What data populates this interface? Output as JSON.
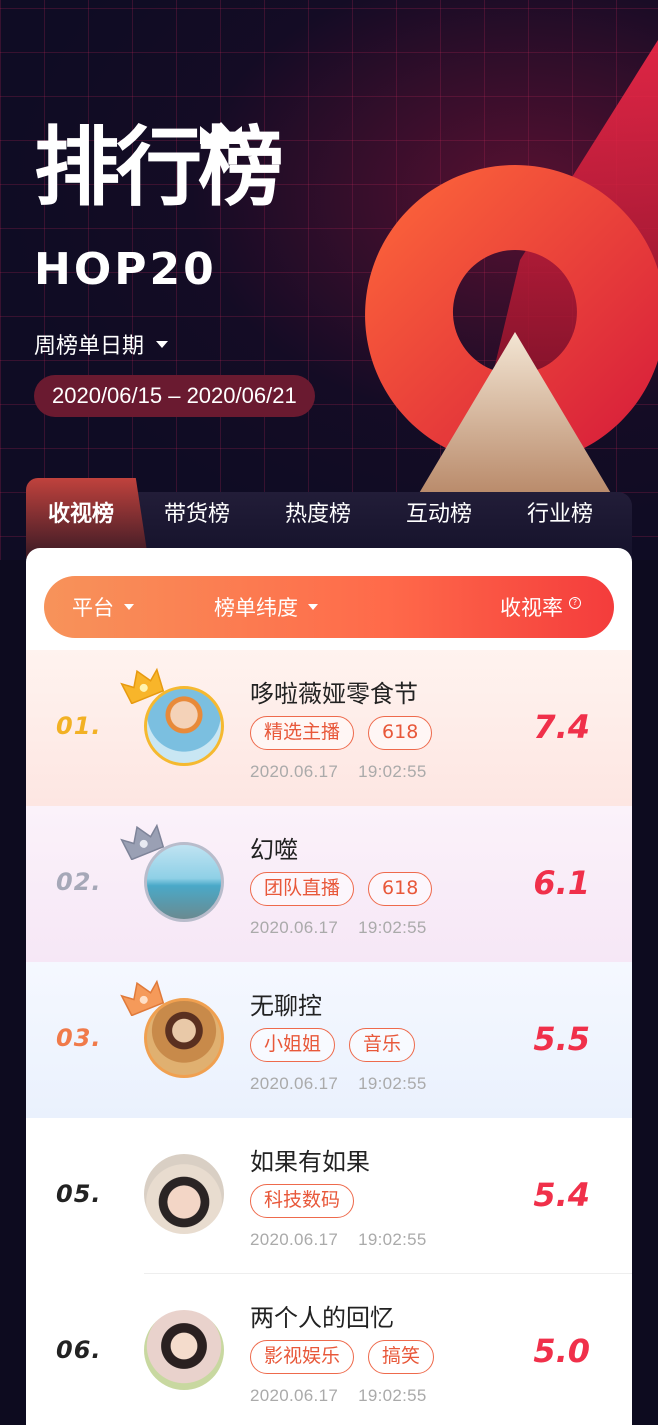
{
  "hero": {
    "title": "排行榜",
    "subtitle": "HOP20",
    "period_label": "周榜单日期",
    "date_range": "2020/06/15 – 2020/06/21"
  },
  "tabs": [
    {
      "label": "收视榜",
      "active": true
    },
    {
      "label": "带货榜",
      "active": false
    },
    {
      "label": "热度榜",
      "active": false
    },
    {
      "label": "互动榜",
      "active": false
    },
    {
      "label": "行业榜",
      "active": false
    }
  ],
  "filters": {
    "platform": "平台",
    "dimension": "榜单纬度",
    "metric": "收视率",
    "metric_help_icon": "?"
  },
  "rows": [
    {
      "rank": "01.",
      "name": "哆啦薇娅零食节",
      "tags": [
        "精选主播",
        "618"
      ],
      "date": "2020.06.17",
      "time": "19:02:55",
      "score": "7.4",
      "crown": "gold",
      "rank_color": "#f2b124"
    },
    {
      "rank": "02.",
      "name": "幻噬",
      "tags": [
        "团队直播",
        "618"
      ],
      "date": "2020.06.17",
      "time": "19:02:55",
      "score": "6.1",
      "crown": "silver",
      "rank_color": "#a6a8b8"
    },
    {
      "rank": "03.",
      "name": "无聊控",
      "tags": [
        "小姐姐",
        "音乐"
      ],
      "date": "2020.06.17",
      "time": "19:02:55",
      "score": "5.5",
      "crown": "bronze",
      "rank_color": "#f07a4a"
    },
    {
      "rank": "05.",
      "name": "如果有如果",
      "tags": [
        "科技数码"
      ],
      "date": "2020.06.17",
      "time": "19:02:55",
      "score": "5.4",
      "crown": "none",
      "rank_color": "#222222"
    },
    {
      "rank": "06.",
      "name": "两个人的回忆",
      "tags": [
        "影视娱乐",
        "搞笑"
      ],
      "date": "2020.06.17",
      "time": "19:02:55",
      "score": "5.0",
      "crown": "none",
      "rank_color": "#222222"
    }
  ],
  "colors": {
    "accent": "#ff6a4a",
    "score": "#f0304a",
    "background": "#0d0b1f"
  }
}
